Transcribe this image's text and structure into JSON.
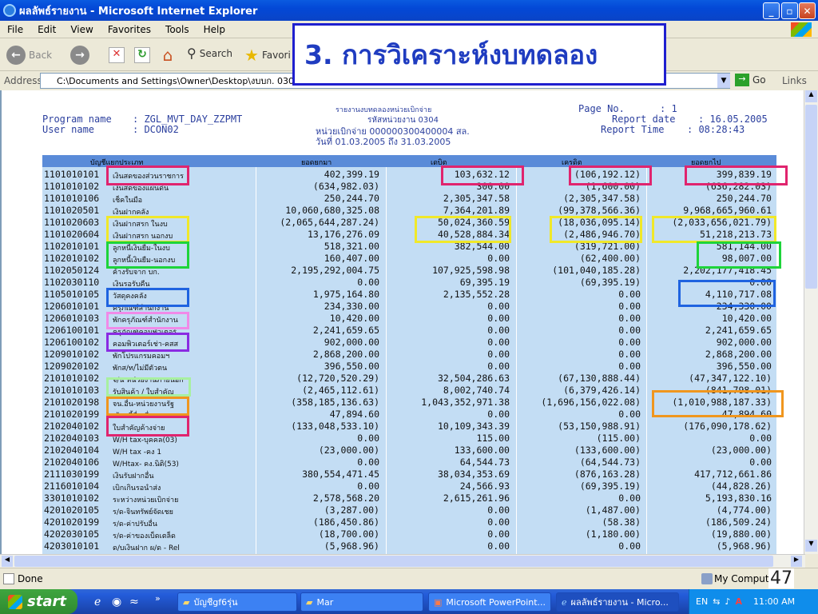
{
  "window": {
    "title": "ผลลัพธ์รายงาน - Microsoft Internet Explorer"
  },
  "menu": [
    "File",
    "Edit",
    "View",
    "Favorites",
    "Tools",
    "Help"
  ],
  "toolbar": {
    "back": "Back",
    "search": "Search",
    "favorites": "Favori"
  },
  "address": {
    "label": "Address",
    "value": "C:\\Documents and Settings\\Owner\\Desktop\\งบบก. 0304\\Mar",
    "go": "Go",
    "links": "Links"
  },
  "overlay_title": "3. การวิเคราะห์งบทดลอง",
  "report": {
    "program_label": "Program name",
    "program_value": ": ZGL_MVT_DAY_ZZPMT",
    "user_label": "User name",
    "user_value": ": DCON02",
    "center_line1": "รายงานงบทดลองหน่วยเบิกจ่าย",
    "center_line2": "รหัสหน่วยงาน  0304",
    "center_line3": "หน่วยเบิกจ่าย 000000300400004 สล.",
    "center_line4": "วันที่ 01.03.2005 ถึง 31.03.2005",
    "page_label": "Page No.",
    "page_value": ":          1",
    "date_label": "Report date",
    "date_value": ": 16.05.2005",
    "time_label": "Report Time",
    "time_value": ": 08:28:43",
    "headers": [
      "บัญชีแยกประเภท",
      "ยอดยกมา",
      "เดบิต",
      "เครดิต",
      "ยอดยกไป"
    ],
    "rows": [
      [
        "1101010101",
        "เงินสดของส่วนราชการ",
        "402,399.19",
        "103,632.12",
        "(106,192.12)",
        "399,839.19"
      ],
      [
        "1101010102",
        "เงินสดของแผ่นดิน",
        "(634,982.03)",
        "300.00",
        "(1,600.00)",
        "(636,282.03)"
      ],
      [
        "1101010106",
        "เช็คในมือ",
        "250,244.70",
        "2,305,347.58",
        "(2,305,347.58)",
        "250,244.70"
      ],
      [
        "1101020501",
        "เงินฝากคลัง",
        "10,060,680,325.08",
        "7,364,201.89",
        "(99,378,566.36)",
        "9,968,665,960.61"
      ],
      [
        "1101020603",
        "เงินฝากสรก  ในงบ",
        "(2,065,644,287.24)",
        "50,024,360.59",
        "(18,036,095.14)",
        "(2,033,656,021.79)"
      ],
      [
        "1101020604",
        "เงินฝากสรก  นอกงบ",
        "13,176,276.09",
        "40,528,884.34",
        "(2,486,946.70)",
        "51,218,213.73"
      ],
      [
        "1102010101",
        "ลูกหนี้เงินยืม-ในงบ",
        "518,321.00",
        "382,544.00",
        "(319,721.00)",
        "581,144.00"
      ],
      [
        "1102010102",
        "ลูกหนี้เงินยืม-นอกงบ",
        "160,407.00",
        "0.00",
        "(62,400.00)",
        "98,007.00"
      ],
      [
        "1102050124",
        "ค้างรับจาก  บก.",
        "2,195,292,004.75",
        "107,925,598.98",
        "(101,040,185.28)",
        "2,202,177,418.45"
      ],
      [
        "1102030110",
        "เงินรอรับคืน",
        "0.00",
        "69,395.19",
        "(69,395.19)",
        "0.00"
      ],
      [
        "1105010105",
        "วัสดุคงคลัง",
        "1,975,164.80",
        "2,135,552.28",
        "0.00",
        "4,110,717.08"
      ],
      [
        "1206010101",
        "ครุภัณฑ์สำนักงาน",
        "234,330.00",
        "0.00",
        "0.00",
        "234,330.00"
      ],
      [
        "1206010103",
        "พักครุภัณฑ์สำนักงาน",
        "10,420.00",
        "0.00",
        "0.00",
        "10,420.00"
      ],
      [
        "1206100101",
        "ครุภัณฑ์คอมพิวเตอร์",
        "2,241,659.65",
        "0.00",
        "0.00",
        "2,241,659.65"
      ],
      [
        "1206100102",
        "คอมพิวเตอร์เช่า-คสส",
        "902,000.00",
        "0.00",
        "0.00",
        "902,000.00"
      ],
      [
        "1209010102",
        "พักโปรแกรมคอมฯ",
        "2,868,200.00",
        "0.00",
        "0.00",
        "2,868,200.00"
      ],
      [
        "1209020102",
        "พักส/ท/ไม่มีตัวตน",
        "396,550.00",
        "0.00",
        "0.00",
        "396,550.00"
      ],
      [
        "2101010102",
        "จ/น  หน่วยงานภายนอก",
        "(12,720,520.29)",
        "32,504,286.63",
        "(67,130,888.44)",
        "(47,347,122.10)"
      ],
      [
        "2101010103",
        "รับสินค้า  /  ใบสำคัญ",
        "(2,465,112.61)",
        "8,002,740.74",
        "(6,379,426.14)",
        "(841,798.01)"
      ],
      [
        "2101020198",
        "จน.อื่น-หน่วยงานรัฐ",
        "(358,185,136.63)",
        "1,043,352,971.38",
        "(1,696,156,022.08)",
        "(1,010,988,187.33)"
      ],
      [
        "2101020199",
        "เจ้าหนี้อื่น  อื่น",
        "47,894.60",
        "0.00",
        "0.00",
        "47,894.60"
      ],
      [
        "2102040102",
        "ใบสำคัญค้างจ่าย",
        "(133,048,533.10)",
        "10,109,343.39",
        "(53,150,988.91)",
        "(176,090,178.62)"
      ],
      [
        "2102040103",
        "W/H  tax-บุคคล(03)",
        "0.00",
        "115.00",
        "(115.00)",
        "0.00"
      ],
      [
        "2102040104",
        "W/H  tax  -คง  1",
        "(23,000.00)",
        "133,600.00",
        "(133,600.00)",
        "(23,000.00)"
      ],
      [
        "2102040106",
        "W/Htax-  คง.นิติ(53)",
        "0.00",
        "64,544.73",
        "(64,544.73)",
        "0.00"
      ],
      [
        "2111030199",
        "เงินรับฝากอื่น",
        "380,554,471.45",
        "38,034,353.69",
        "(876,163.28)",
        "417,712,661.86"
      ],
      [
        "2116010104",
        "เบิกเกินรอนำส่ง",
        "0.00",
        "24,566.93",
        "(69,395.19)",
        "(44,828.26)"
      ],
      [
        "3301010102",
        "ระหว่างหน่วยเบิกจ่าย",
        "2,578,568.20",
        "2,615,261.96",
        "0.00",
        "5,193,830.16"
      ],
      [
        "4201020105",
        "ร/ด-จินทรัพย์จัดเชย",
        "(3,287.00)",
        "0.00",
        "(1,487.00)",
        "(4,774.00)"
      ],
      [
        "4201020199",
        "ร/ด-ค่าปรับอื่น",
        "(186,450.86)",
        "0.00",
        "(58.38)",
        "(186,509.24)"
      ],
      [
        "4202030105",
        "ร/ด-ค่าของเบ็ดเตล็ด",
        "(18,700.00)",
        "0.00",
        "(1,180.00)",
        "(19,880.00)"
      ],
      [
        "4203010101",
        "ด/บเงินฝาก  ผ/ด  -  Rel",
        "(5,968.96)",
        "0.00",
        "0.00",
        "(5,968.96)"
      ]
    ]
  },
  "status": {
    "left": "Done",
    "zone": "My Computer",
    "page_number": "47"
  },
  "taskbar": {
    "start": "start",
    "tasks": [
      "บัญชีgf6รุ่น",
      "Mar",
      "Microsoft PowerPoint...",
      "ผลลัพธ์รายงาน - Micro..."
    ],
    "lang": "EN",
    "clock": "11:00 AM"
  },
  "colors": {
    "row_bg": "#C3DDF4",
    "header_bg": "#5A8BD8",
    "text_blue": "#2b3f9e"
  }
}
